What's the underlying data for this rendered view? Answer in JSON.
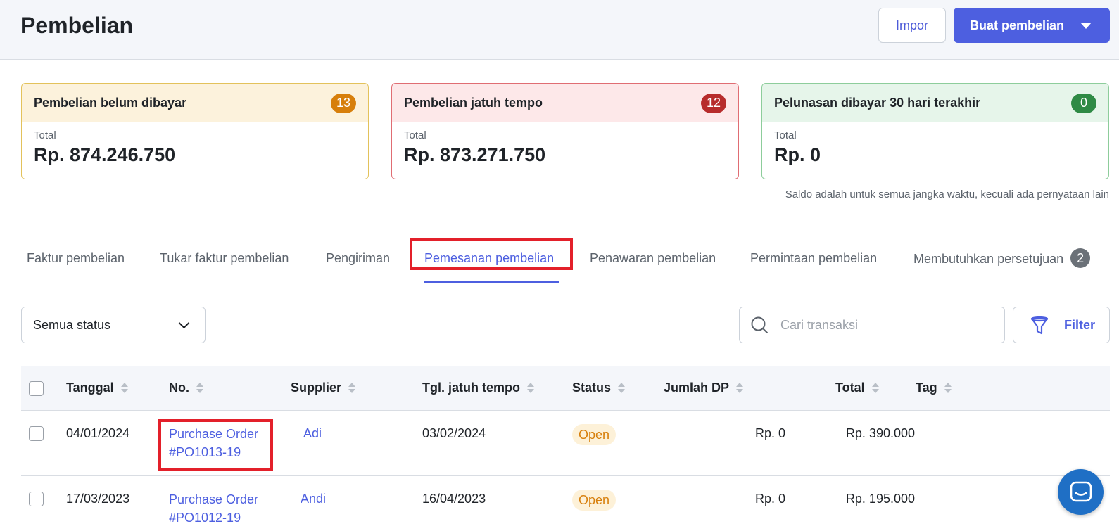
{
  "header": {
    "title": "Pembelian",
    "import_label": "Impor",
    "create_label": "Buat pembelian"
  },
  "cards": [
    {
      "title": "Pembelian belum dibayar",
      "badge": "13",
      "sub": "Total",
      "amount": "Rp. 874.246.750"
    },
    {
      "title": "Pembelian jatuh tempo",
      "badge": "12",
      "sub": "Total",
      "amount": "Rp. 873.271.750"
    },
    {
      "title": "Pelunasan dibayar 30 hari terakhir",
      "badge": "0",
      "sub": "Total",
      "amount": "Rp. 0"
    }
  ],
  "balance_note": "Saldo adalah untuk semua jangka waktu, kecuali ada pernyataan lain",
  "tabs": [
    {
      "label": "Faktur pembelian"
    },
    {
      "label": "Tukar faktur pembelian"
    },
    {
      "label": "Pengiriman"
    },
    {
      "label": "Pemesanan pembelian"
    },
    {
      "label": "Penawaran pembelian"
    },
    {
      "label": "Permintaan pembelian"
    },
    {
      "label": "Membutuhkan persetujuan",
      "count": "2"
    }
  ],
  "filters": {
    "status_selected": "Semua status",
    "search_placeholder": "Cari transaksi",
    "filter_label": "Filter"
  },
  "table": {
    "columns": [
      "Tanggal",
      "No.",
      "Supplier",
      "Tgl. jatuh tempo",
      "Status",
      "Jumlah DP",
      "Total",
      "Tag"
    ],
    "rows": [
      {
        "date": "04/01/2024",
        "no": "Purchase Order #PO1013-19",
        "supplier": "Adi",
        "due": "03/02/2024",
        "status": "Open",
        "dp": "Rp. 0",
        "total": "Rp. 390.000",
        "tag": ""
      },
      {
        "date": "17/03/2023",
        "no": "Purchase Order #PO1012-19",
        "supplier": "Andi",
        "due": "16/04/2023",
        "status": "Open",
        "dp": "Rp. 0",
        "total": "Rp. 195.000",
        "tag": ""
      }
    ]
  },
  "colors": {
    "accent": "#4d5fe0",
    "highlight": "#e3202a"
  }
}
